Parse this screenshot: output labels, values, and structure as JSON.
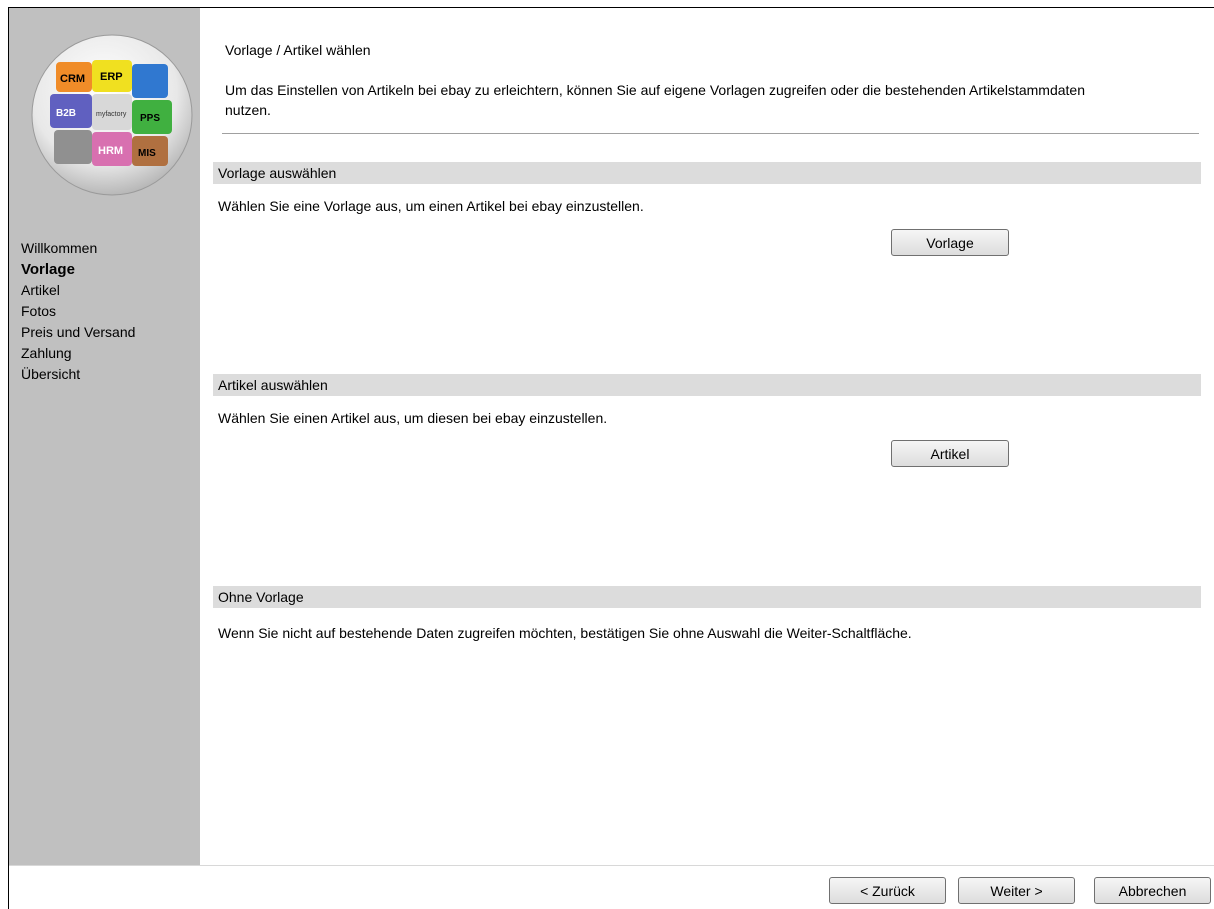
{
  "sidebar": {
    "logo_labels": [
      "CRM",
      "ERP",
      "B2B",
      "myfactory",
      "PPS",
      "HRM",
      "MIS"
    ],
    "items": [
      {
        "label": "Willkommen",
        "active": false
      },
      {
        "label": "Vorlage",
        "active": true
      },
      {
        "label": "Artikel",
        "active": false
      },
      {
        "label": "Fotos",
        "active": false
      },
      {
        "label": "Preis und Versand",
        "active": false
      },
      {
        "label": "Zahlung",
        "active": false
      },
      {
        "label": "Übersicht",
        "active": false
      }
    ]
  },
  "header": {
    "title": "Vorlage / Artikel wählen",
    "description": "Um das Einstellen von Artikeln bei ebay zu erleichtern, können Sie auf eigene Vorlagen zugreifen oder die bestehenden Artikelstammdaten nutzen."
  },
  "sections": [
    {
      "heading": "Vorlage auswählen",
      "text": "Wählen Sie eine Vorlage aus, um einen Artikel bei ebay einzustellen.",
      "button": "Vorlage"
    },
    {
      "heading": "Artikel auswählen",
      "text": "Wählen Sie einen Artikel aus, um diesen bei ebay einzustellen.",
      "button": "Artikel"
    },
    {
      "heading": "Ohne Vorlage",
      "text": "Wenn Sie nicht auf bestehende Daten zugreifen möchten, bestätigen Sie ohne Auswahl die Weiter-Schaltfläche."
    }
  ],
  "footer": {
    "back_label": "< Zurück",
    "next_label": "Weiter >",
    "cancel_label": "Abbrechen"
  },
  "colors": {
    "sidebar_bg": "#c0c0c0",
    "section_head_bg": "#dcdcdc"
  }
}
